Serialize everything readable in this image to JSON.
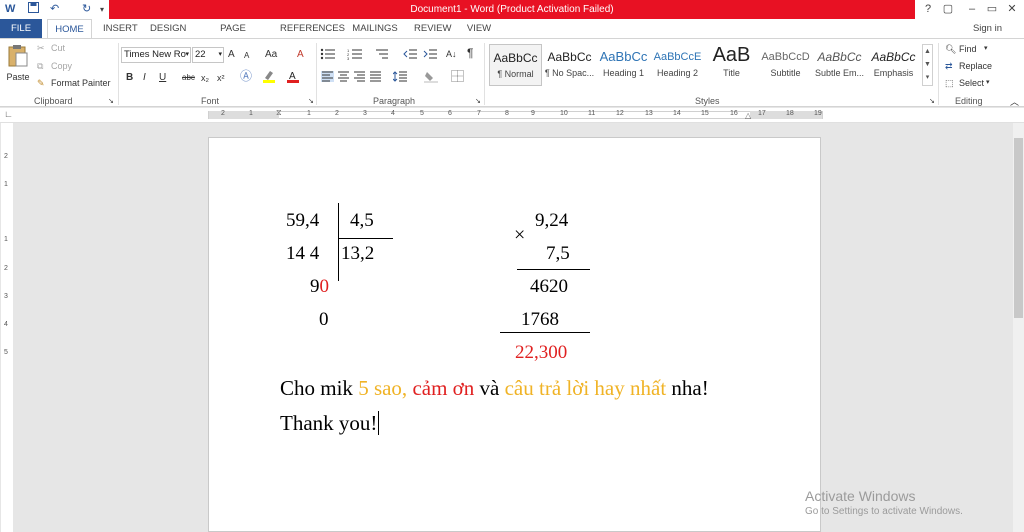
{
  "window": {
    "title": "Document1 - Word (Product Activation Failed)",
    "controls": [
      "?",
      "▢",
      "–",
      "▭",
      "✕"
    ]
  },
  "qat": [
    "W",
    "💾",
    "↶",
    "↻",
    "▾"
  ],
  "tabs": [
    "FILE",
    "HOME",
    "INSERT",
    "DESIGN",
    "PAGE LAYOUT",
    "REFERENCES",
    "MAILINGS",
    "REVIEW",
    "VIEW"
  ],
  "signin": "Sign in",
  "clipboard": {
    "paste": "Paste",
    "cut": "Cut",
    "copy": "Copy",
    "format_painter": "Format Painter",
    "label": "Clipboard"
  },
  "font": {
    "name": "Times New Ro",
    "size": "22",
    "label": "Font",
    "grow": "A",
    "shrink": "A",
    "case": "Aa",
    "clear": "A",
    "bold": "B",
    "italic": "I",
    "underline": "U",
    "strike": "abc",
    "sub": "x₂",
    "sup": "x²"
  },
  "paragraph": {
    "label": "Paragraph",
    "show": "¶"
  },
  "styles": {
    "label": "Styles",
    "items": [
      {
        "preview": "AaBbCc",
        "name": "¶ Normal"
      },
      {
        "preview": "AaBbCc",
        "name": "¶ No Spac..."
      },
      {
        "preview": "AaBbCc",
        "name": "Heading 1"
      },
      {
        "preview": "AaBbCcE",
        "name": "Heading 2"
      },
      {
        "preview": "AaB",
        "name": "Title"
      },
      {
        "preview": "AaBbCcD",
        "name": "Subtitle"
      },
      {
        "preview": "AaBbCc",
        "name": "Subtle Em..."
      },
      {
        "preview": "AaBbCc",
        "name": "Emphasis"
      }
    ]
  },
  "editing": {
    "label": "Editing",
    "find": "Find",
    "replace": "Replace",
    "select": "Select"
  },
  "ruler": {
    "numbers": [
      "2",
      "1",
      "1",
      "2",
      "3",
      "4",
      "5",
      "6",
      "7",
      "8",
      "9",
      "10",
      "11",
      "12",
      "13",
      "14",
      "15",
      "16",
      "17",
      "18",
      "19"
    ],
    "vnumbers": [
      "2",
      "1",
      "1",
      "2",
      "3",
      "4",
      "5"
    ]
  },
  "document": {
    "division": {
      "dividend": "59,4",
      "divisor": "4,5",
      "step1": "14 4",
      "quotient": "13,2",
      "step2_black": "9",
      "step2_red": "0",
      "remainder": "0"
    },
    "multiplication": {
      "sign": "×",
      "a": "9,24",
      "b": "7,5",
      "p1": "4620",
      "p2": "1768",
      "result": "22,300"
    },
    "line1": {
      "part1": "Cho mik ",
      "part2": "5 sao,",
      "part3": " cảm ơn",
      "part4": " và ",
      "part5": "câu trả lời hay nhất",
      "part6": " nha!"
    },
    "line2": "Thank you!"
  },
  "watermark": {
    "line1": "Activate Windows",
    "line2": "Go to Settings to activate Windows."
  },
  "colors": {
    "titlebar": "#e81123",
    "accent": "#2b579a",
    "red": "#e02020",
    "orange": "#f0b326"
  }
}
